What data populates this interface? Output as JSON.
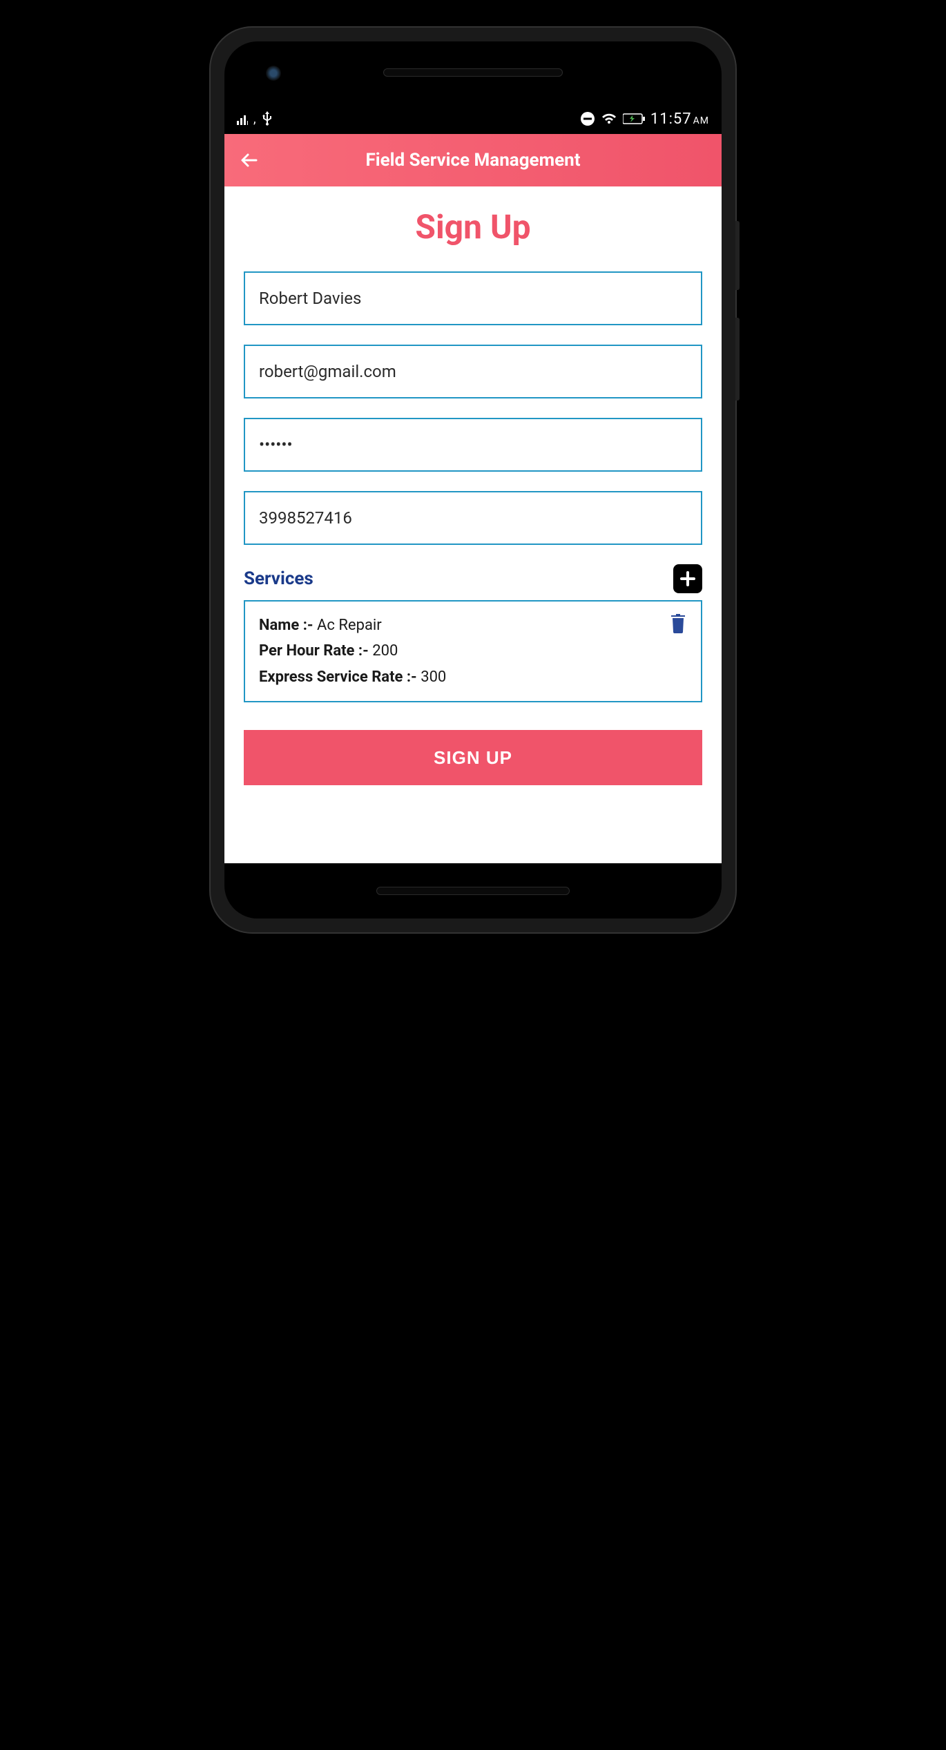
{
  "status_bar": {
    "time": "11:57",
    "ampm": "AM"
  },
  "app_bar": {
    "title": "Field Service Management"
  },
  "page": {
    "title": "Sign Up"
  },
  "form": {
    "name": "Robert Davies",
    "email": "robert@gmail.com",
    "password": "••••••",
    "phone": "3998527416"
  },
  "services": {
    "label": "Services",
    "items": [
      {
        "name_label": "Name :- ",
        "name_value": "Ac Repair",
        "rate_label": "Per Hour Rate :- ",
        "rate_value": "200",
        "express_label": "Express Service Rate :- ",
        "express_value": "300"
      }
    ]
  },
  "buttons": {
    "signup": "SIGN UP"
  },
  "colors": {
    "accent": "#f0546a",
    "input_border": "#2196c4",
    "services_label": "#1a3a8a"
  }
}
